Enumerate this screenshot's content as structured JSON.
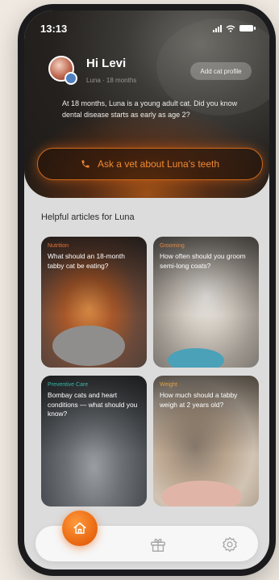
{
  "status": {
    "time": "13:13"
  },
  "header": {
    "greeting": "Hi Levi",
    "sub": "Luna · 18 months",
    "add_cat_label": "Add cat profile",
    "message": "At 18 months, Luna is a young adult cat. Did you know dental disease starts as early as age 2?",
    "cta_label": "Ask a vet about Luna's teeth"
  },
  "articles": {
    "title": "Helpful articles for Luna",
    "items": [
      {
        "category": "Nutrition",
        "category_color": "#e4733a",
        "title": "What should an 18-month tabby cat be eating?"
      },
      {
        "category": "Grooming",
        "category_color": "#e08a45",
        "title": "How often should you groom semi-long coats?"
      },
      {
        "category": "Preventive Care",
        "category_color": "#39b6a6",
        "title": "Bombay cats and heart conditions — what should you know?"
      },
      {
        "category": "Weight",
        "category_color": "#e0a040",
        "title": "How much should a tabby weigh at 2 years old?"
      }
    ]
  },
  "nav": {
    "items": [
      "home-icon",
      "gift-icon",
      "settings-icon"
    ],
    "active": "home-icon"
  },
  "colors": {
    "accent": "#e8650f",
    "background": "#dcdcdc"
  }
}
